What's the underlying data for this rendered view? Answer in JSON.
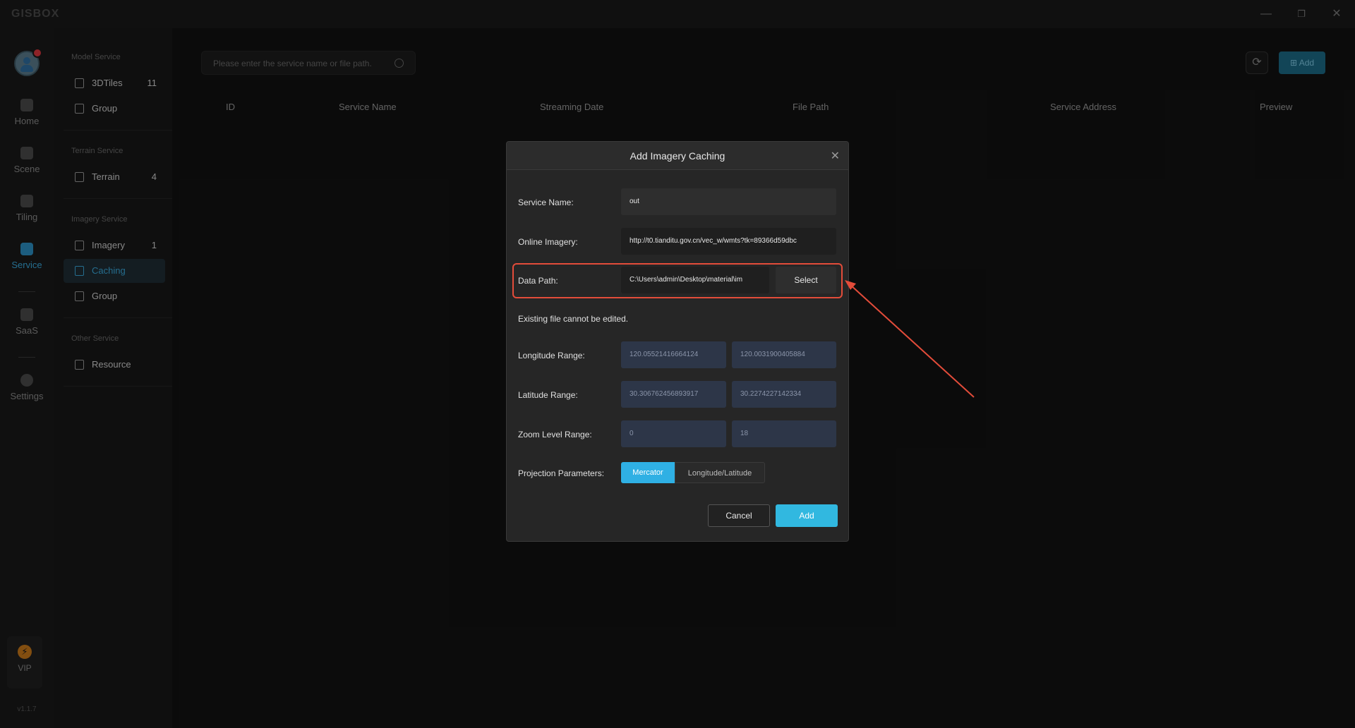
{
  "app": {
    "logo": "GISBOX"
  },
  "window": {
    "minimize": "—",
    "restore": "❐",
    "close": "✕"
  },
  "nav": {
    "items": [
      {
        "label": "Home"
      },
      {
        "label": "Scene"
      },
      {
        "label": "Tiling"
      },
      {
        "label": "Service"
      },
      {
        "label": "SaaS"
      },
      {
        "label": "Settings"
      }
    ],
    "vip": "VIP",
    "version": "v1.1.7"
  },
  "sidebar": {
    "model_title": "Model Service",
    "model_items": [
      {
        "label": "3DTiles",
        "count": "11"
      },
      {
        "label": "Group",
        "count": ""
      }
    ],
    "terrain_title": "Terrain Service",
    "terrain_items": [
      {
        "label": "Terrain",
        "count": "4"
      }
    ],
    "imagery_title": "Imagery Service",
    "imagery_items": [
      {
        "label": "Imagery",
        "count": "1"
      },
      {
        "label": "Caching",
        "count": ""
      },
      {
        "label": "Group",
        "count": ""
      }
    ],
    "other_title": "Other Service",
    "other_items": [
      {
        "label": "Resource",
        "count": ""
      }
    ]
  },
  "search": {
    "placeholder": "Please enter the service name or file path."
  },
  "toolbar": {
    "refresh_icon": "⟳",
    "add_label": "Add"
  },
  "table": {
    "headers": [
      "ID",
      "Service Name",
      "Streaming Date",
      "File Path",
      "Service Address",
      "Preview"
    ]
  },
  "modal": {
    "title": "Add Imagery Caching",
    "close": "✕",
    "service_name_label": "Service Name:",
    "service_name_value": "out",
    "online_imagery_label": "Online Imagery:",
    "online_imagery_value": "http://t0.tianditu.gov.cn/vec_w/wmts?tk=89366d59dbc",
    "data_path_label": "Data Path:",
    "data_path_value": "C:\\Users\\admin\\Desktop\\material\\im",
    "select_label": "Select",
    "note": "Existing file cannot be edited.",
    "longitude_label": "Longitude Range:",
    "longitude_min": "120.05521416664124",
    "longitude_max": "120.0031900405884",
    "latitude_label": "Latitude Range:",
    "latitude_min": "30.306762456893917",
    "latitude_max": "30.2274227142334",
    "zoom_label": "Zoom Level Range:",
    "zoom_min": "0",
    "zoom_max": "18",
    "projection_label": "Projection Parameters:",
    "projection_options": [
      "Mercator",
      "Longitude/Latitude"
    ],
    "projection_selected": "Mercator",
    "cancel_label": "Cancel",
    "add_label": "Add"
  },
  "colors": {
    "accent": "#31b8e0",
    "highlight": "#e34c3a"
  }
}
